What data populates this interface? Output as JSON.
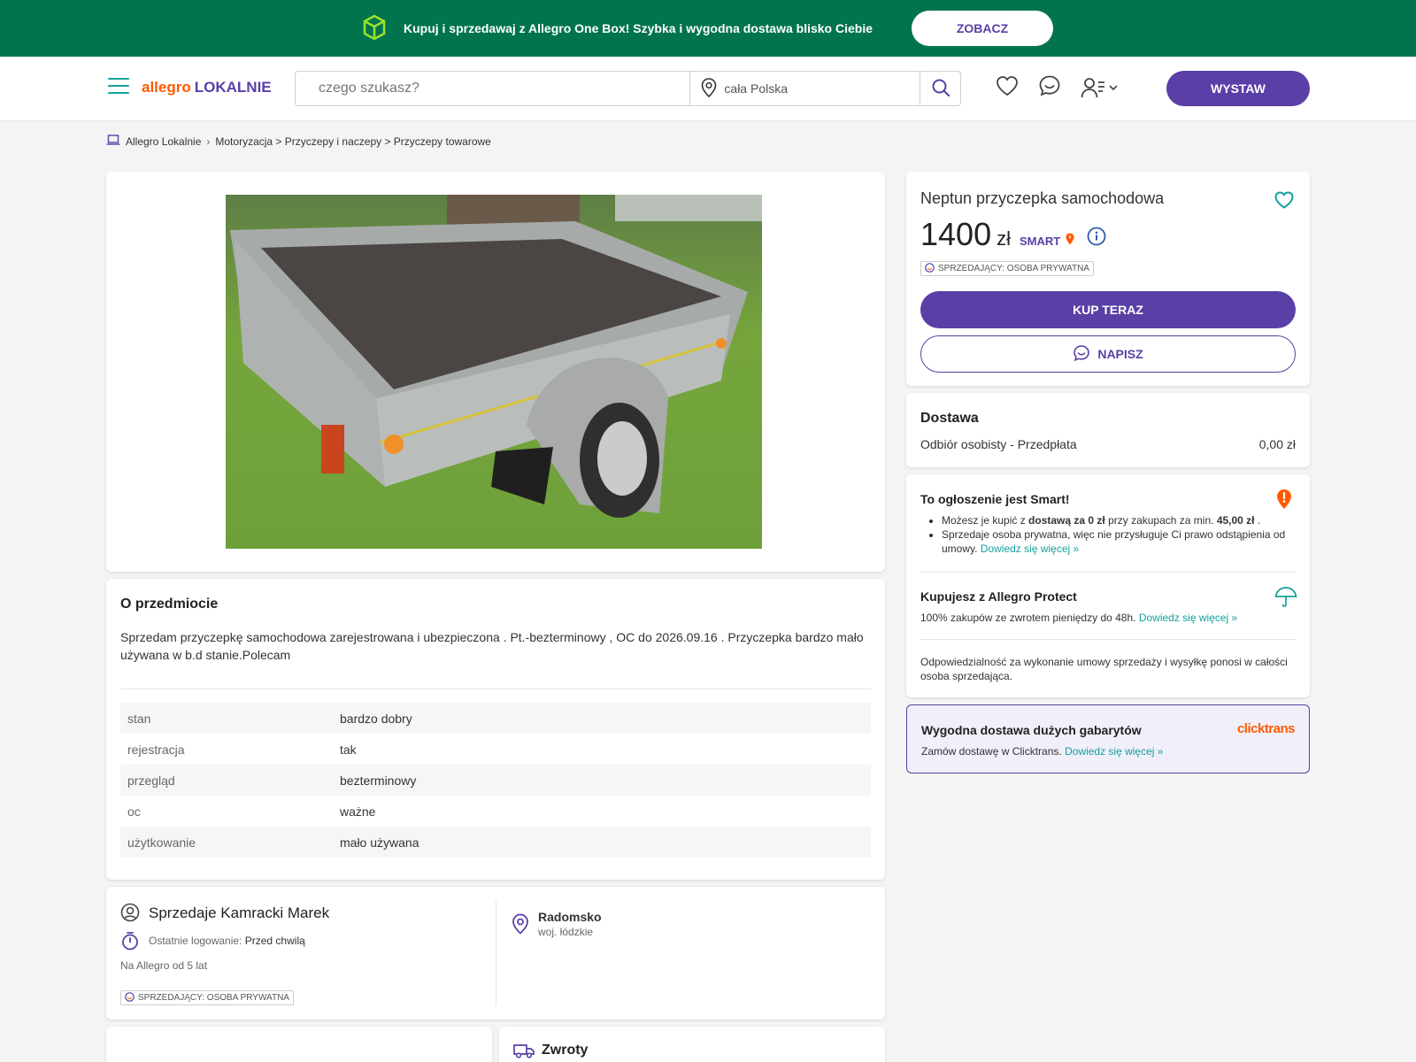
{
  "promo": {
    "text": "Kupuj i sprzedawaj z Allegro One Box! Szybka i wygodna dostawa blisko Ciebie",
    "button": "ZOBACZ"
  },
  "header": {
    "logo_allegro": "allegro",
    "logo_lokalnie": "LOKALNIE",
    "search_placeholder": "czego szukasz?",
    "location": "cała Polska",
    "post_button": "WYSTAW"
  },
  "breadcrumb": {
    "home": "Allegro Lokalnie",
    "path": "Motoryzacja > Przyczepy i naczepy > Przyczepy towarowe"
  },
  "item": {
    "about_title": "O przedmiocie",
    "description": "Sprzedam przyczepkę samochodowa zarejestrowana i ubezpieczona . Pt.-bezterminowy , OC do 2026.09.16 . Przyczepka bardzo mało używana w b.d stanie.Polecam",
    "attributes": [
      {
        "key": "stan",
        "value": "bardzo dobry"
      },
      {
        "key": "rejestracja",
        "value": "tak"
      },
      {
        "key": "przegląd",
        "value": "bezterminowy"
      },
      {
        "key": "oc",
        "value": "ważne"
      },
      {
        "key": "użytkowanie",
        "value": "mało używana"
      }
    ]
  },
  "seller": {
    "title": "Sprzedaje Kamracki Marek",
    "last_login_label": "Ostatnie logowanie:",
    "last_login_value": "Przed chwilą",
    "since": "Na Allegro od 5 lat",
    "badge": "SPRZEDAJĄCY: OSOBA PRYWATNA",
    "city": "Radomsko",
    "region": "woj. łódzkie"
  },
  "returns_title": "Zwroty",
  "offer": {
    "title": "Neptun przyczepka samochodowa",
    "price": "1400",
    "currency": "zł",
    "smart_label": "SMART",
    "badge": "SPRZEDAJĄCY: OSOBA PRYWATNA",
    "buy_button": "KUP TERAZ",
    "message_button": "NAPISZ"
  },
  "delivery": {
    "title": "Dostawa",
    "method": "Odbiór osobisty - Przedpłata",
    "price": "0,00 zł"
  },
  "smart_info": {
    "title": "To ogłoszenie jest Smart!",
    "b1_pre": "Możesz je kupić z ",
    "b1_bold": "dostawą za 0 zł",
    "b1_mid": " przy zakupach za min. ",
    "b1_amount": "45,00 zł",
    "b1_end": " .",
    "b2": "Sprzedaje osoba prywatna, więc nie przysługuje Ci prawo odstąpienia od umowy.",
    "b2_link": "Dowiedz się więcej »",
    "protect_title": "Kupujesz z Allegro Protect",
    "protect_text": "100% zakupów ze zwrotem pieniędzy do 48h.",
    "protect_link": "Dowiedz się więcej »",
    "responsibility": "Odpowiedzialność za wykonanie umowy sprzedaży i wysyłkę ponosi w całości osoba sprzedająca."
  },
  "clicktrans": {
    "title": "Wygodna dostawa dużych gabarytów",
    "logo": "clicktrans",
    "text": "Zamów dostawę w Clicktrans.",
    "link": "Dowiedz się więcej »"
  },
  "colors": {
    "brand_purple": "#5a3fa6",
    "promo_green": "#01744e",
    "link_teal": "#13a19c",
    "allegro_orange": "#ff5a00"
  }
}
